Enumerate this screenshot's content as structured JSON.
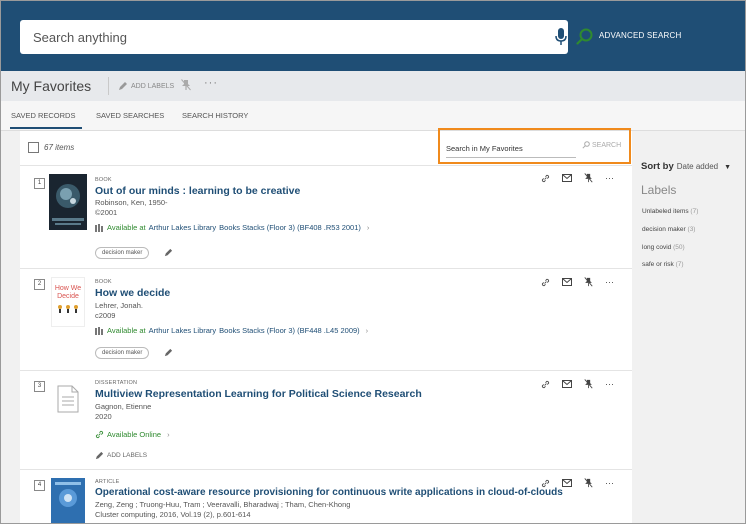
{
  "search": {
    "placeholder": "Search anything",
    "advanced_label": "ADVANCED SEARCH"
  },
  "favorites": {
    "title": "My Favorites",
    "add_labels": "ADD LABELS",
    "more": "···"
  },
  "tabs": [
    {
      "label": "SAVED RECORDS",
      "active": true
    },
    {
      "label": "SAVED SEARCHES",
      "active": false
    },
    {
      "label": "SEARCH HISTORY",
      "active": false
    }
  ],
  "list": {
    "count_label": "67 items",
    "search_placeholder": "Search in My Favorites",
    "search_button": "SEARCH"
  },
  "records": [
    {
      "num": "1",
      "type": "BOOK",
      "title": "Out of our minds : learning to be creative",
      "author": "Robinson, Ken, 1950-",
      "date": "©2001",
      "available_text": "Available at",
      "library": "Arthur Lakes Library",
      "location": "Books Stacks (Floor 3) (BF408 .R53 2001)",
      "label": "decision maker"
    },
    {
      "num": "2",
      "type": "BOOK",
      "title": "How we decide",
      "author": "Lehrer, Jonah.",
      "date": "c2009",
      "available_text": "Available at",
      "library": "Arthur Lakes Library",
      "location": "Books Stacks (Floor 3) (BF448 .L45 2009)",
      "label": "decision maker",
      "cover_text": [
        "How We",
        "Decide"
      ]
    },
    {
      "num": "3",
      "type": "DISSERTATION",
      "title": "Multiview Representation Learning for Political Science Research",
      "author": "Gagnon, Etienne",
      "date": "2020",
      "available_text": "Available Online",
      "add_labels": "ADD LABELS"
    },
    {
      "num": "4",
      "type": "ARTICLE",
      "title": "Operational cost-aware resource provisioning for continuous write applications in cloud-of-clouds",
      "author": "Zeng, Zeng ; Truong-Huu, Tram ; Veeravalli, Bharadwaj ; Tham, Chen-Khong",
      "date": "Cluster computing, 2016, Vol.19 (2), p.601-614"
    }
  ],
  "sidebar": {
    "sort_label": "Sort by",
    "sort_value": "Date added",
    "labels_heading": "Labels",
    "labels": [
      {
        "name": "Unlabeled items",
        "count": "(7)"
      },
      {
        "name": "decision maker",
        "count": "(3)"
      },
      {
        "name": "long covid",
        "count": "(50)"
      },
      {
        "name": "safe or risk",
        "count": "(7)"
      }
    ]
  },
  "colors": {
    "header": "#1f4e75",
    "link": "#1f4e75",
    "available": "#2f8a2f",
    "highlight": "#f08a1c"
  }
}
